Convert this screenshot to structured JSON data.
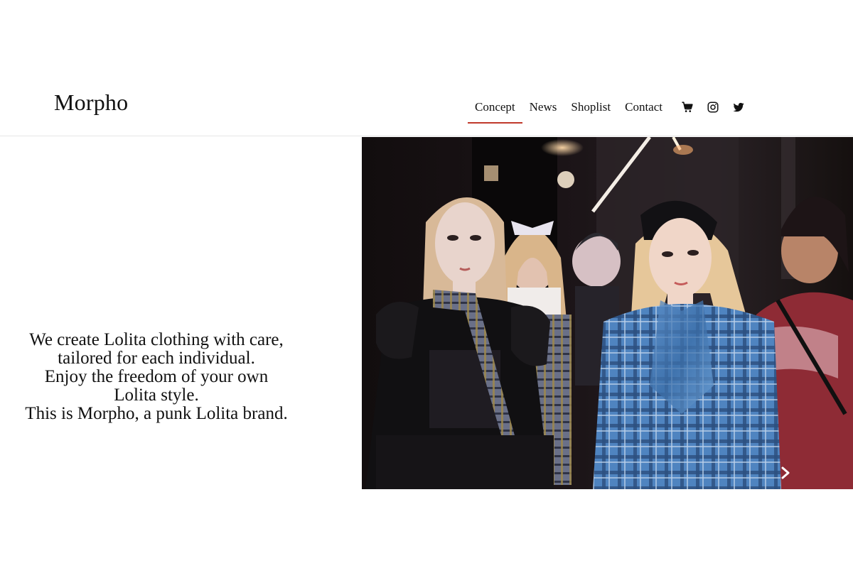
{
  "header": {
    "logo": "Morpho",
    "nav": [
      {
        "label": "Concept",
        "active": true
      },
      {
        "label": "News",
        "active": false
      },
      {
        "label": "Shoplist",
        "active": false
      },
      {
        "label": "Contact",
        "active": false
      }
    ],
    "icons": [
      "cart-icon",
      "instagram-icon",
      "twitter-icon"
    ],
    "accent_color": "#c0392b"
  },
  "tagline": {
    "lines": [
      "We create Lolita clothing with care,",
      "tailored for each individual.",
      "Enjoy the freedom of your own",
      "Lolita style.",
      "This is Morpho, a punk Lolita brand."
    ]
  },
  "hero": {
    "icon": "chevron-right-icon"
  }
}
